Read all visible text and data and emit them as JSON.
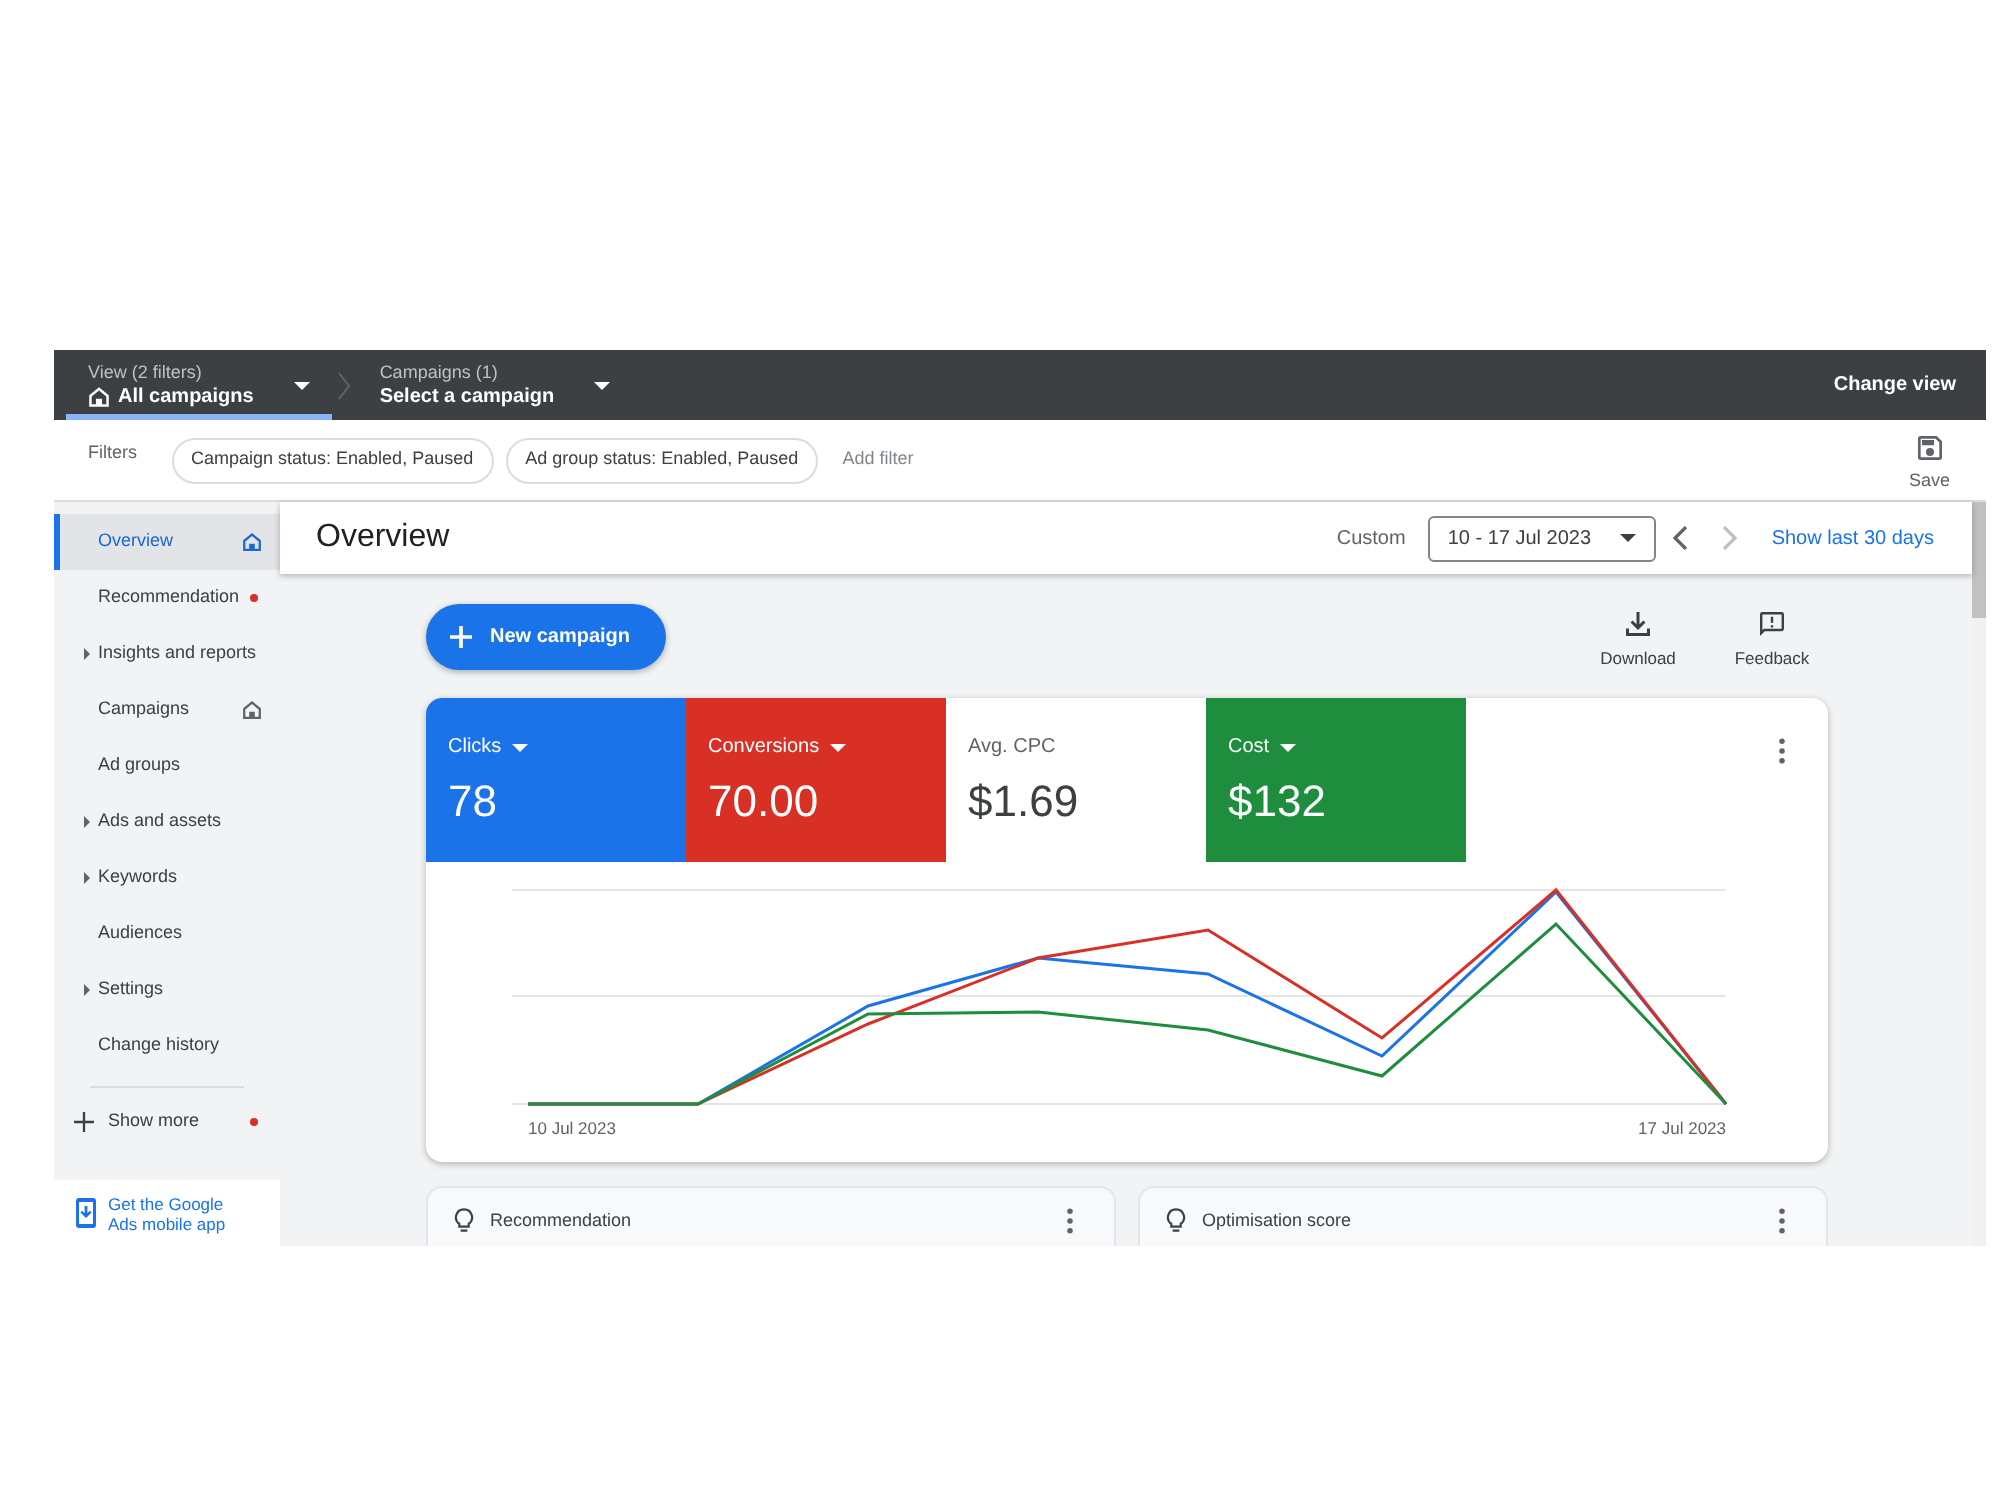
{
  "top_bar": {
    "crumbs": [
      {
        "label": "View (2 filters)",
        "value": "All campaigns",
        "selected": true
      },
      {
        "label": "Campaigns (1)",
        "value": "Select a campaign",
        "selected": false
      }
    ],
    "action": "Change view"
  },
  "filter_bar": {
    "label": "Filters",
    "chips": [
      "Campaign status: Enabled, Paused",
      "Ad group status: Enabled, Paused"
    ],
    "add_filter": "Add filter",
    "save": "Save"
  },
  "sidebar": {
    "items": [
      {
        "label": "Overview",
        "kind": "page",
        "selected": true,
        "home": true,
        "notification": false
      },
      {
        "label": "Recommendation",
        "kind": "page",
        "selected": false,
        "home": false,
        "notification": true
      },
      {
        "label": "Insights and reports",
        "kind": "group",
        "selected": false,
        "home": false,
        "notification": false
      },
      {
        "label": "Campaigns",
        "kind": "page",
        "selected": false,
        "home": true,
        "notification": false
      },
      {
        "label": "Ad groups",
        "kind": "page",
        "selected": false,
        "home": false,
        "notification": false
      },
      {
        "label": "Ads and assets",
        "kind": "group",
        "selected": false,
        "home": false,
        "notification": false
      },
      {
        "label": "Keywords",
        "kind": "group",
        "selected": false,
        "home": false,
        "notification": false
      },
      {
        "label": "Audiences",
        "kind": "page",
        "selected": false,
        "home": false,
        "notification": false
      },
      {
        "label": "Settings",
        "kind": "group",
        "selected": false,
        "home": false,
        "notification": false
      },
      {
        "label": "Change history",
        "kind": "page",
        "selected": false,
        "home": false,
        "notification": false
      }
    ],
    "show_more": {
      "label": "Show more",
      "notification": true
    },
    "app_link": "Get the Google Ads mobile app"
  },
  "header": {
    "title": "Overview",
    "range_label": "Custom",
    "date_range": "10 - 17 Jul 2023",
    "nav": [
      {
        "kind": "prev",
        "disabled": false
      },
      {
        "kind": "next",
        "disabled": true
      }
    ],
    "link": "Show last 30 days"
  },
  "toolbar": {
    "new_button": "New campaign",
    "actions": [
      {
        "kind": "download",
        "label": "Download"
      },
      {
        "kind": "feedback",
        "label": "Feedback"
      }
    ]
  },
  "metrics": [
    {
      "label": "Clicks",
      "value": "78",
      "selected": true,
      "color": "#1a73e8"
    },
    {
      "label": "Conversions",
      "value": "70.00",
      "selected": true,
      "color": "#d93025"
    },
    {
      "label": "Avg. CPC",
      "value": "$1.69",
      "selected": false
    },
    {
      "label": "Cost",
      "value": "$132",
      "selected": true,
      "color": "#1e8e3e"
    }
  ],
  "chart": {
    "start_label": "10 Jul 2023",
    "end_label": "17 Jul 2023"
  },
  "cards": [
    {
      "title": "Recommendation"
    },
    {
      "title": "Optimisation score"
    }
  ]
}
